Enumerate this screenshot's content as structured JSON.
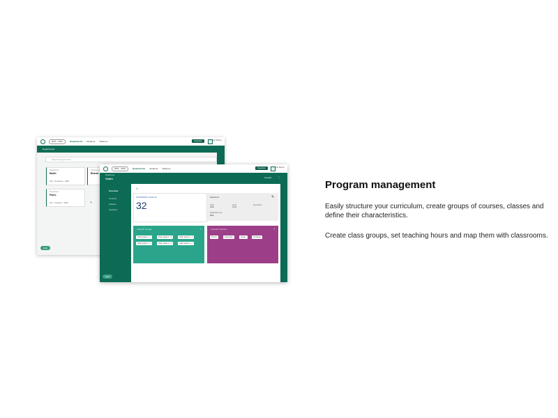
{
  "back_window": {
    "year_select": "2021 - 2022",
    "nav": [
      "Departments",
      "Students",
      "Teachers"
    ],
    "upgrade": "Upgrade",
    "user": "Your School",
    "section_title": "Departments",
    "search_placeholder": "Search Departments",
    "cards": [
      {
        "label": "Department",
        "name": "Ballet",
        "stats": "4/21 · 32 Classes · 18/28"
      },
      {
        "label": "Department",
        "name": "Bharat",
        "stats": ""
      },
      {
        "label": "Department",
        "name": "Piano",
        "stats": "4/21 · 9 Classes · 18/28"
      }
    ],
    "help": "Help"
  },
  "front_window": {
    "year_select": "2021 - 2022",
    "nav": [
      "Departments",
      "Students",
      "Teachers"
    ],
    "upgrade": "Upgrade",
    "user": "Your School",
    "breadcrumb": "Department",
    "page_title": "Violin",
    "header_action": "Contact",
    "sidebar": [
      "Overview",
      "Courses",
      "Classes",
      "Teachers"
    ],
    "stat_link": "ATTENDING Students",
    "stat_value": "32",
    "info_title": "Department",
    "info_fields": [
      {
        "k": "Head",
        "v": "Violin"
      },
      {
        "k": "Code",
        "v": "VI-10"
      },
      {
        "k": "Description",
        "v": ""
      },
      {
        "k": "Registration fee",
        "v": "$100"
      }
    ],
    "green_card": {
      "search": "Search Groups",
      "chips": [
        "Violin grade 1 - 4",
        "Violin grade 1 - 4",
        "Violin grade 1 - 4",
        "Violin grade 1 - 4",
        "Violin grade 1 - 4",
        "Violin grade 1 - 4"
      ]
    },
    "purple_card": {
      "search": "Search Courses",
      "chips": [
        "Theory",
        "Repertoire",
        "Scales",
        "Technique"
      ]
    },
    "help": "Help"
  },
  "right_panel": {
    "title": "Program management",
    "paragraph1": "Easily structure your curriculum, create groups of courses, classes and define their characteristics.",
    "paragraph2": "Create class groups, set teaching hours and map them with classrooms."
  },
  "colors": {
    "brand_green": "#0d6b55",
    "card_green": "#2aa58b",
    "card_purple": "#9c3f88"
  }
}
